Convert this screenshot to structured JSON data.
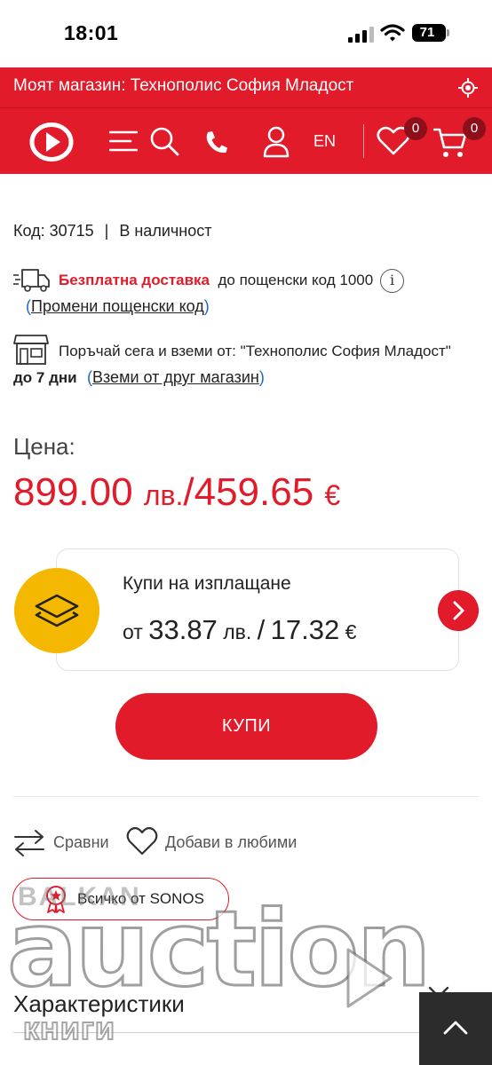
{
  "status_bar": {
    "time": "18:01",
    "battery": "71"
  },
  "store_bar": {
    "text": "Моят магазин: Технополис София Младост"
  },
  "nav": {
    "lang": "EN",
    "wishlist_count": "0",
    "cart_count": "0"
  },
  "product": {
    "code_label": "Код: 30715",
    "separator": "|",
    "availability": "В наличност"
  },
  "delivery": {
    "free_label": "Безплатна доставка",
    "postal_text": "до пощенски код 1000",
    "info": "i",
    "change_link": "Промени пощенски код"
  },
  "pickup": {
    "text": "Поръчай сега и вземи от:  \"Технополис София Младост\"",
    "days": "до 7 дни",
    "other_store_link": "Вземи от друг магазин"
  },
  "price": {
    "label": "Цена:",
    "bgn": "899.00",
    "bgn_currency": "лв.",
    "slash": "/",
    "eur": "459.65",
    "eur_currency": "€"
  },
  "installment": {
    "title": "Купи на изплащане",
    "prefix": "от",
    "bgn": "33.87",
    "bgn_currency": "лв.",
    "slash": "/",
    "eur": "17.32",
    "eur_currency": "€"
  },
  "buy_button": {
    "label": "КУПИ"
  },
  "actions": {
    "compare": "Сравни",
    "favorite": "Добави в любими"
  },
  "brand": {
    "label": "Всичко от SONOS"
  },
  "specs": {
    "title": "Характеристики"
  },
  "watermark": {
    "line1": "BALKAN",
    "line2": "auction",
    "line3": "книги"
  },
  "colors": {
    "brand_red": "#e21b2b",
    "installment_yellow": "#f5b800",
    "link_blue": "#1e66c8"
  },
  "icons": [
    "signal-icon",
    "wifi-icon",
    "battery-icon",
    "location-icon",
    "logo-play-icon",
    "menu-icon",
    "search-icon",
    "phone-icon",
    "user-icon",
    "heart-icon",
    "cart-icon",
    "truck-icon",
    "info-icon",
    "store-icon",
    "layers-icon",
    "chevron-right-icon",
    "compare-arrows-icon",
    "award-icon",
    "chevron-down-icon",
    "chevron-up-icon"
  ]
}
